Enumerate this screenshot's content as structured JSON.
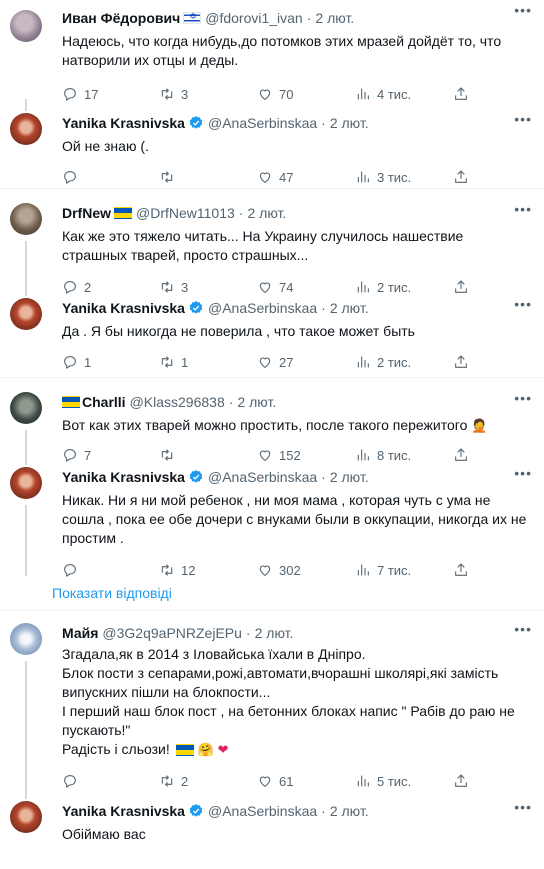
{
  "tweets": [
    {
      "name": "Иван Фёдорович",
      "handle": "@fdorovi1_ivan",
      "date": "2 лют.",
      "text": "Надеюсь, что когда нибудь,до потомков этих мразей дойдёт то, что натворили их отцы и деды.",
      "replies": "17",
      "retweets": "3",
      "likes": "70",
      "views": "4 тис."
    },
    {
      "name": "Yanika Krasnivska",
      "handle": "@AnaSerbinskaa",
      "date": "2 лют.",
      "text": "Ой не знаю (.",
      "replies": "",
      "retweets": "",
      "likes": "47",
      "views": "3 тис."
    },
    {
      "name": "DrfNew",
      "handle": "@DrfNew11013",
      "date": "2 лют.",
      "text": "Как же это тяжело читать... На Украину случилось нашествие страшных тварей, просто страшных...",
      "replies": "2",
      "retweets": "3",
      "likes": "74",
      "views": "2 тис."
    },
    {
      "name": "Yanika Krasnivska",
      "handle": "@AnaSerbinskaa",
      "date": "2 лют.",
      "text": "Да . Я бы никогда не поверила , что такое может быть",
      "replies": "1",
      "retweets": "1",
      "likes": "27",
      "views": "2 тис."
    },
    {
      "name": "Charlli",
      "handle": "@Klass296838",
      "date": "2 лют.",
      "text": "Вот как этих тварей можно простить, после такого пережитого",
      "replies": "7",
      "retweets": "",
      "likes": "152",
      "views": "8 тис."
    },
    {
      "name": "Yanika Krasnivska",
      "handle": "@AnaSerbinskaa",
      "date": "2 лют.",
      "text": "Никак. Ни я ни мой ребенок , ни моя мама , которая чуть с ума не сошла , пока ее обе дочери с внуками были в оккупации, никогда их не простим .",
      "replies": "",
      "retweets": "12",
      "likes": "302",
      "views": "7 тис."
    },
    {
      "name": "Майя",
      "handle": "@3G2q9aPNRZejEPu",
      "date": "2 лют.",
      "text_lines": [
        "Згадала,як в 2014 з Іловайська їхали в Дніпро.",
        "Блок пости з сепарами,рожі,автомати,вчорашні школярі,які замість випускних пішли на блокпости...",
        "І перший наш блок пост , на бетонних блоках напис \" Рабів до раю не пускають!\"",
        "Радість і сльози!"
      ],
      "replies": "",
      "retweets": "2",
      "likes": "61",
      "views": "5 тис."
    },
    {
      "name": "Yanika Krasnivska",
      "handle": "@AnaSerbinskaa",
      "date": "2 лют.",
      "text": "Обіймаю вас"
    }
  ],
  "show_replies_label": "Показати відповіді",
  "dot": "·",
  "icons": {
    "reply": "reply-icon",
    "retweet": "retweet-icon",
    "like": "heart-icon",
    "views": "views-icon",
    "share": "share-icon",
    "more": "more-icon",
    "verified": "verified-badge-icon"
  },
  "colors": {
    "accent": "#1d9bf0",
    "muted": "#536471",
    "text": "#0f1419",
    "divider": "#eff3f4"
  }
}
